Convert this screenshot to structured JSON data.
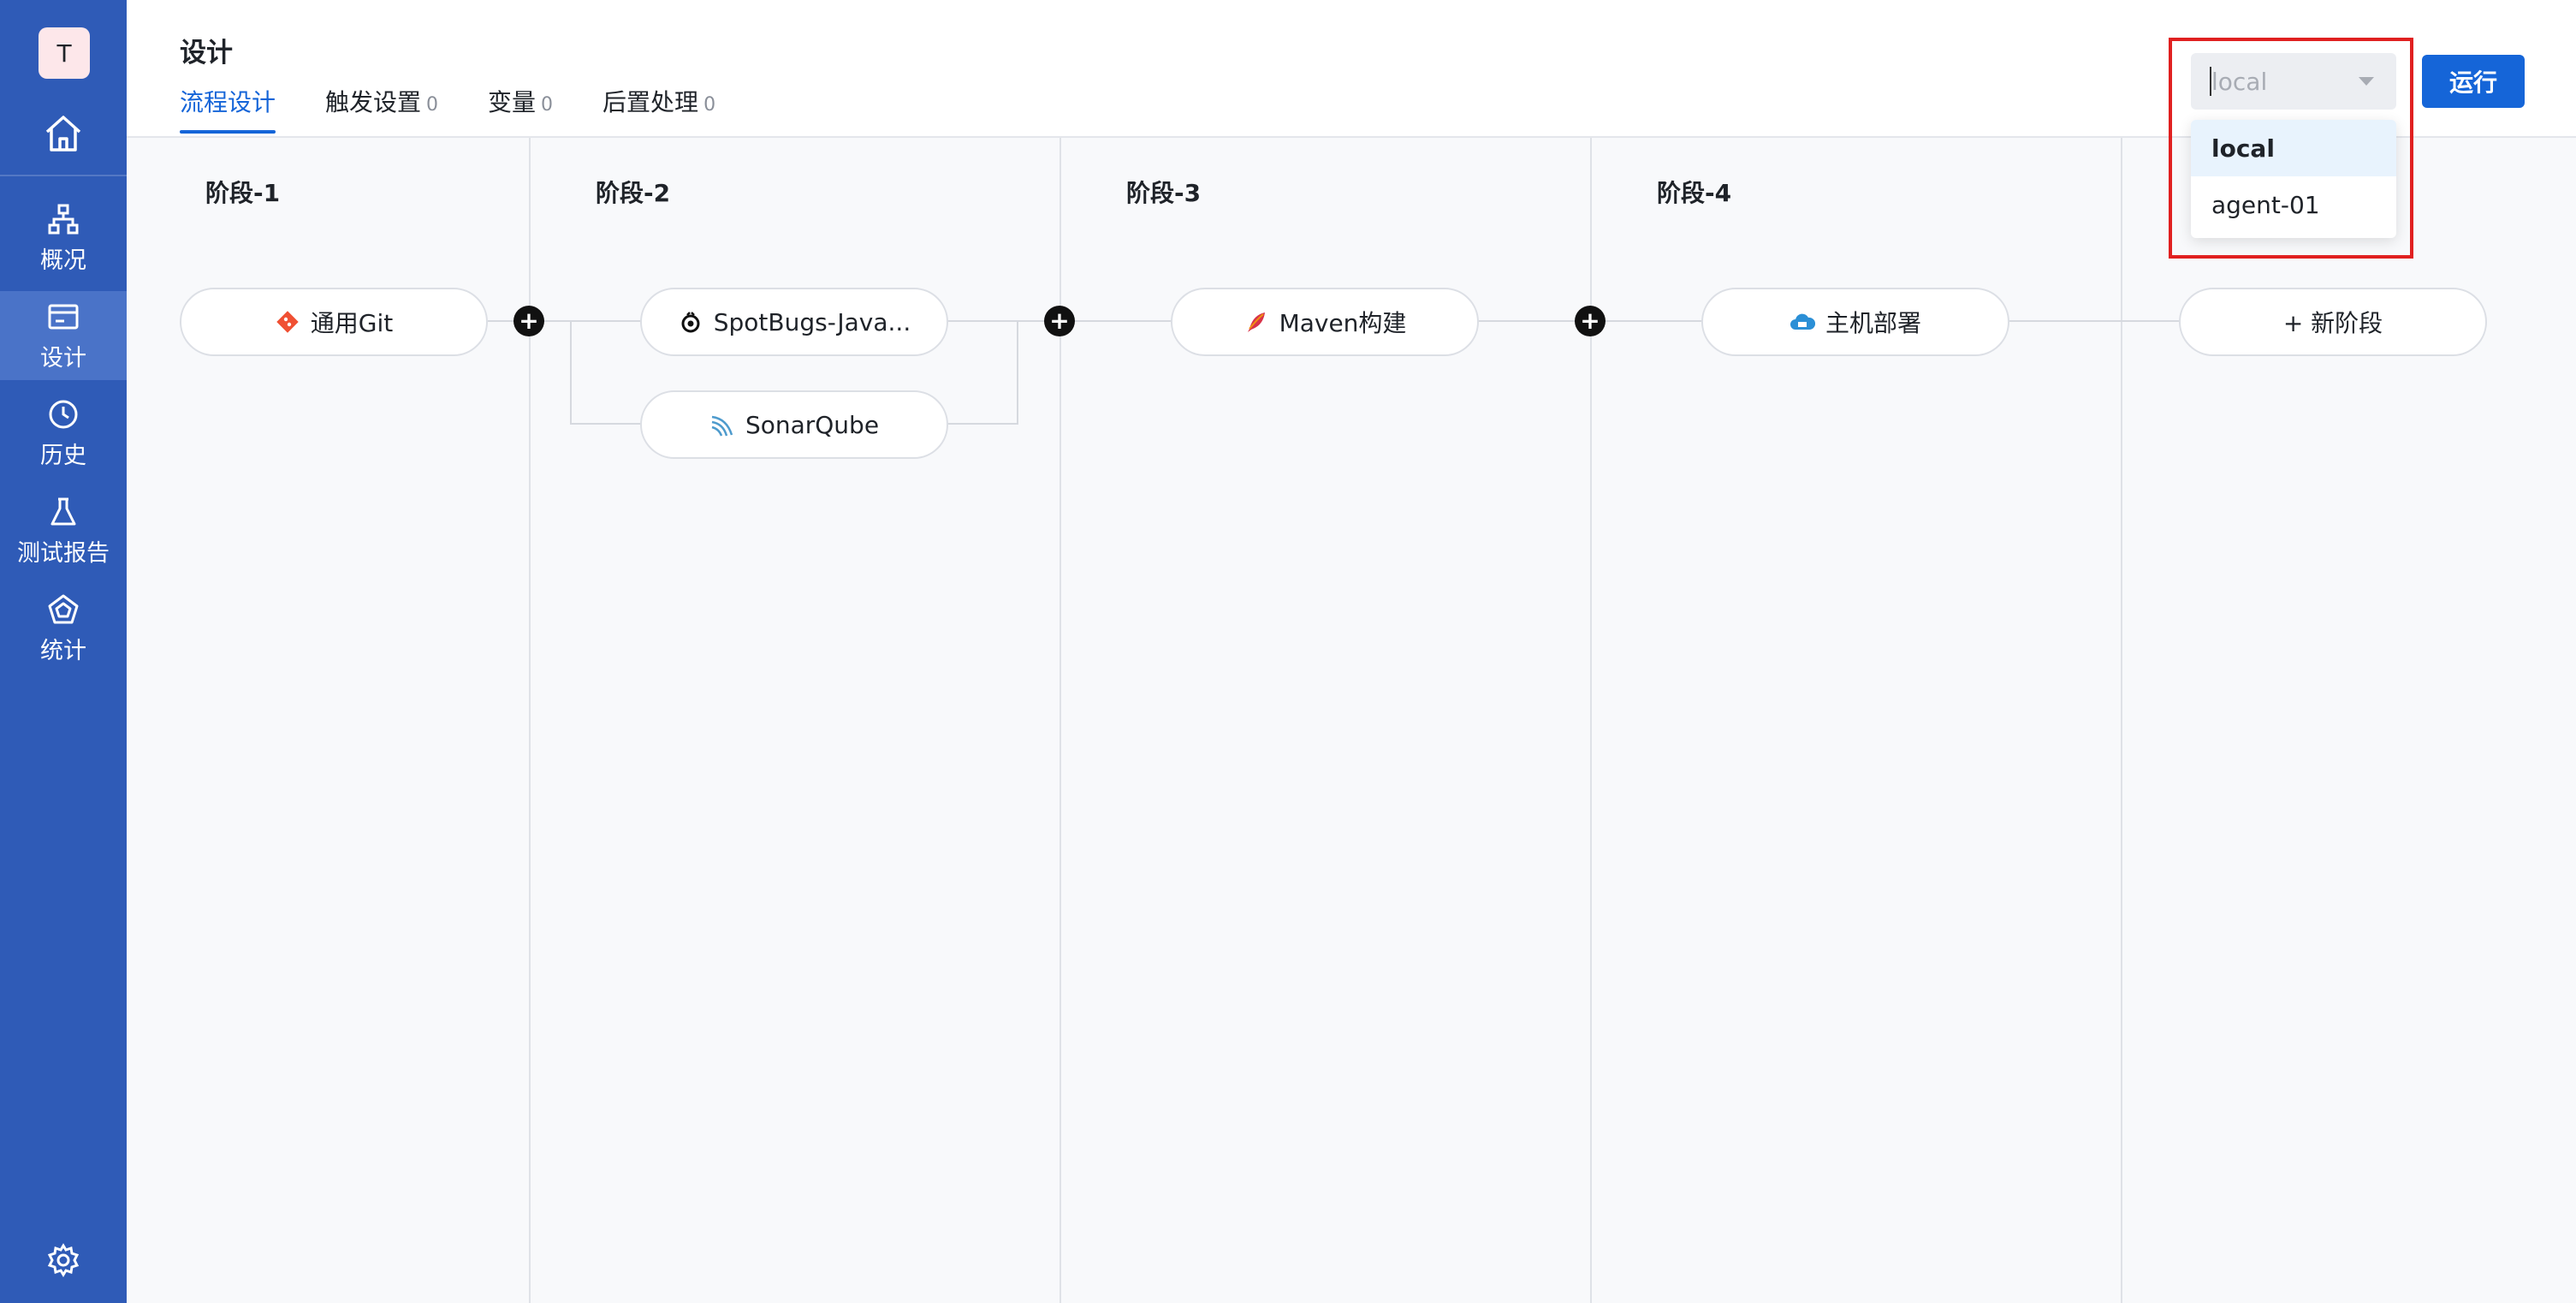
{
  "sidebar": {
    "avatar_letter": "T",
    "items": [
      {
        "label": "概况",
        "icon": "network-icon"
      },
      {
        "label": "设计",
        "icon": "card-icon",
        "active": true
      },
      {
        "label": "历史",
        "icon": "clock-icon"
      },
      {
        "label": "测试报告",
        "icon": "flask-icon"
      },
      {
        "label": "统计",
        "icon": "pentagon-chart-icon"
      }
    ]
  },
  "header": {
    "title": "设计",
    "tabs": [
      {
        "label": "流程设计",
        "count": ""
      },
      {
        "label": "触发设置",
        "count": "0"
      },
      {
        "label": "变量",
        "count": "0"
      },
      {
        "label": "后置处理",
        "count": "0"
      }
    ]
  },
  "stages": [
    {
      "label": "阶段-1",
      "tasks": [
        "通用Git"
      ]
    },
    {
      "label": "阶段-2",
      "tasks": [
        "SpotBugs-Java...",
        "SonarQube"
      ]
    },
    {
      "label": "阶段-3",
      "tasks": [
        "Maven构建"
      ]
    },
    {
      "label": "阶段-4",
      "tasks": [
        "主机部署"
      ]
    }
  ],
  "new_stage_label": "+ 新阶段",
  "plus_symbol": "+",
  "runner": {
    "placeholder": "local",
    "options": [
      "local",
      "agent-01"
    ],
    "selected": "local"
  },
  "run_button": "运行",
  "colors": {
    "sidebar": "#2f5bb7",
    "accent": "#1565d8",
    "highlight": "#e02020"
  }
}
